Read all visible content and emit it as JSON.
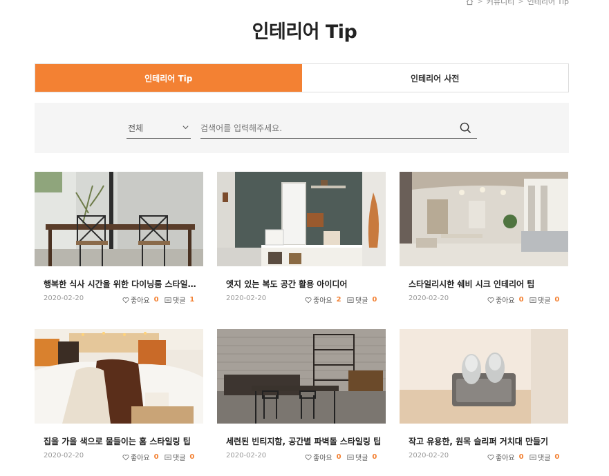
{
  "breadcrumb": {
    "items": [
      "커뮤니티",
      "인테리어 Tip"
    ]
  },
  "page": {
    "title": "인테리어 Tip"
  },
  "tabs": [
    {
      "label": "인테리어 Tip",
      "active": true
    },
    {
      "label": "인테리어 사전",
      "active": false
    }
  ],
  "search": {
    "category": "전체",
    "placeholder": "검색어를 입력해주세요.",
    "value": ""
  },
  "labels": {
    "likes": "좋아요",
    "comments": "댓글"
  },
  "accent_color": "#f38133",
  "posts": [
    {
      "title": "행복한 식사 시간을 위한 다이닝룸 스타일…",
      "date": "2020-02-20",
      "likes": "0",
      "comments": "1"
    },
    {
      "title": "엣지 있는 복도 공간 활용 아이디어",
      "date": "2020-02-20",
      "likes": "2",
      "comments": "0"
    },
    {
      "title": "스타일리시한 쉐비 시크 인테리어 팁",
      "date": "2020-02-20",
      "likes": "0",
      "comments": "0"
    },
    {
      "title": "집을 가을 색으로 물들이는 홈 스타일링 팁",
      "date": "2020-02-20",
      "likes": "0",
      "comments": "0"
    },
    {
      "title": "세련된 빈티지함, 공간별 파벽돌 스타일링 팁",
      "date": "2020-02-20",
      "likes": "0",
      "comments": "0"
    },
    {
      "title": "작고 유용한, 원목 슬리퍼 거치대 만들기",
      "date": "2020-02-20",
      "likes": "0",
      "comments": "0"
    }
  ]
}
